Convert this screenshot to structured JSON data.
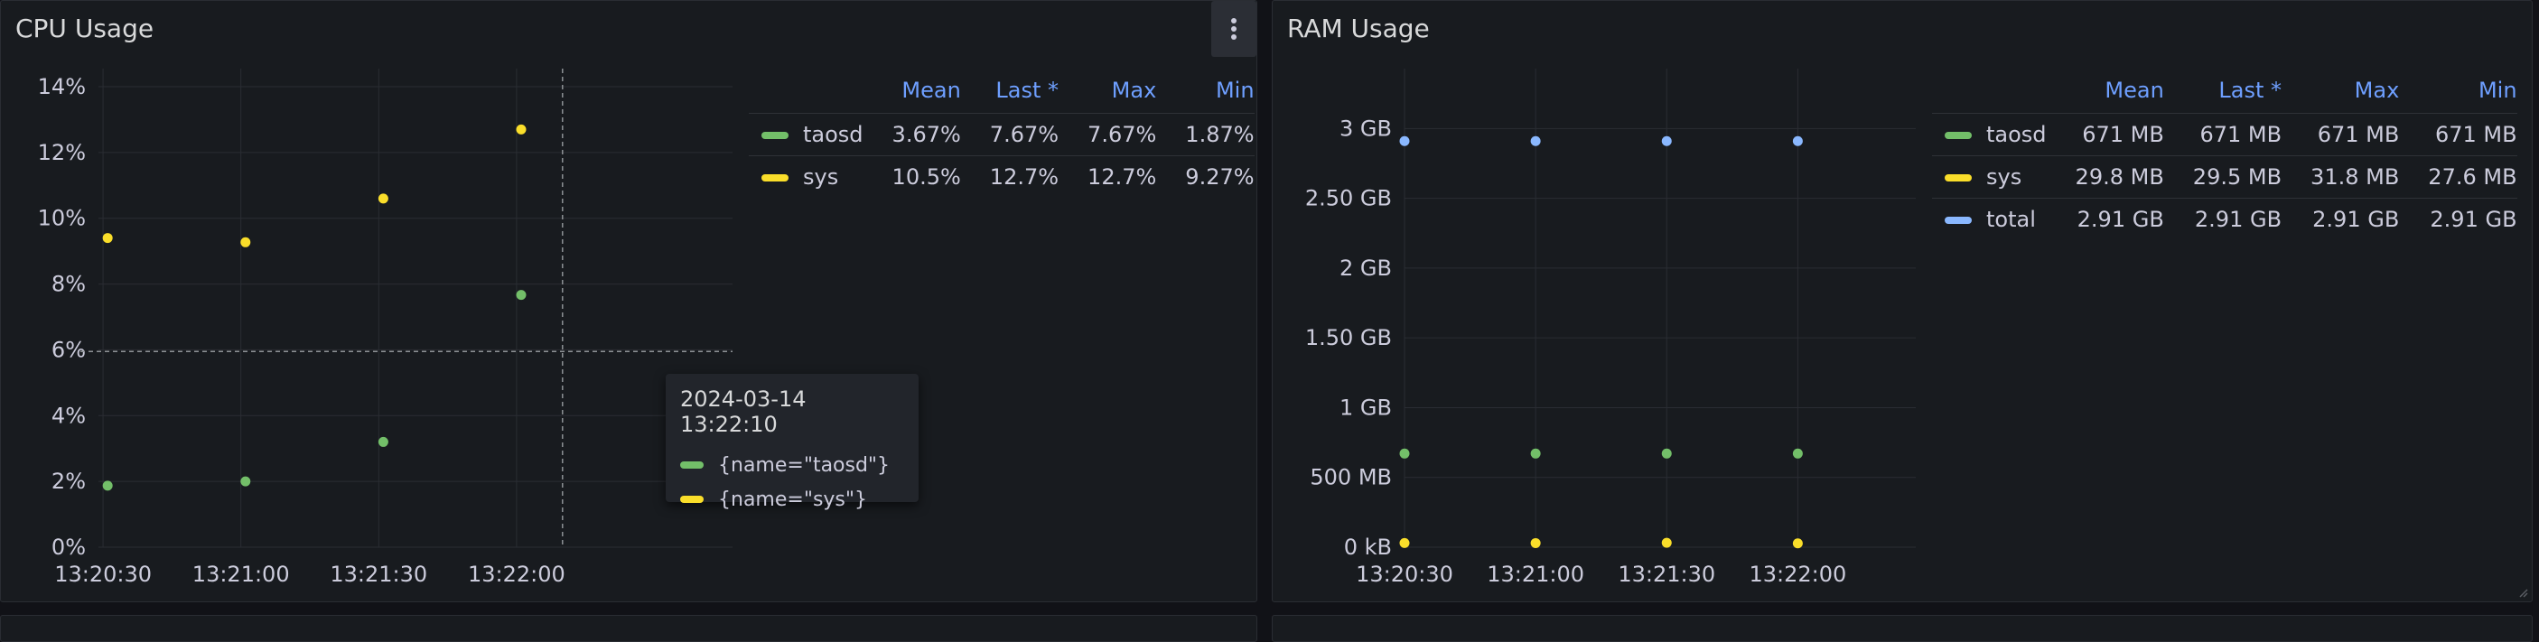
{
  "colors": {
    "taosd": "#73bf69",
    "sys": "#fade2a",
    "total": "#8ab8ff",
    "header": "#6e9fff"
  },
  "cpu_panel": {
    "title": "CPU Usage",
    "menu_icon": "kebab-menu-icon",
    "legend": {
      "headers": [
        "Mean",
        "Last *",
        "Max",
        "Min"
      ],
      "rows": [
        {
          "name": "taosd",
          "color": "#73bf69",
          "mean": "3.67%",
          "last": "7.67%",
          "max": "7.67%",
          "min": "1.87%"
        },
        {
          "name": "sys",
          "color": "#fade2a",
          "mean": "10.5%",
          "last": "12.7%",
          "max": "12.7%",
          "min": "9.27%"
        }
      ]
    },
    "tooltip": {
      "time": "2024-03-14 13:22:10",
      "items": [
        {
          "label": "{name=\"taosd\"}",
          "color": "#73bf69"
        },
        {
          "label": "{name=\"sys\"}",
          "color": "#fade2a"
        }
      ]
    }
  },
  "ram_panel": {
    "title": "RAM Usage",
    "legend": {
      "headers": [
        "Mean",
        "Last *",
        "Max",
        "Min"
      ],
      "rows": [
        {
          "name": "taosd",
          "color": "#73bf69",
          "mean": "671 MB",
          "last": "671 MB",
          "max": "671 MB",
          "min": "671 MB"
        },
        {
          "name": "sys",
          "color": "#fade2a",
          "mean": "29.8 MB",
          "last": "29.5 MB",
          "max": "31.8 MB",
          "min": "27.6 MB"
        },
        {
          "name": "total",
          "color": "#8ab8ff",
          "mean": "2.91 GB",
          "last": "2.91 GB",
          "max": "2.91 GB",
          "min": "2.91 GB"
        }
      ]
    }
  },
  "chart_data": [
    {
      "type": "scatter",
      "title": "CPU Usage",
      "x_tick_labels": [
        "13:20:30",
        "13:21:00",
        "13:21:30",
        "13:22:00"
      ],
      "y_tick_labels": [
        "0%",
        "2%",
        "4%",
        "6%",
        "8%",
        "10%",
        "12%",
        "14%"
      ],
      "xlim": [
        "13:20:29",
        "13:22:47"
      ],
      "ylim": [
        0,
        14
      ],
      "unit": "%",
      "grid": true,
      "legend": "right-table",
      "hover_x": "13:22:10",
      "hover_y": 5.95,
      "series": [
        {
          "name": "taosd",
          "color": "#73bf69",
          "x": [
            "13:20:31",
            "13:21:01",
            "13:21:31",
            "13:22:01"
          ],
          "y": [
            1.87,
            2.0,
            3.2,
            7.67
          ]
        },
        {
          "name": "sys",
          "color": "#fade2a",
          "x": [
            "13:20:31",
            "13:21:01",
            "13:21:31",
            "13:22:01"
          ],
          "y": [
            9.4,
            9.27,
            10.6,
            12.7
          ]
        }
      ]
    },
    {
      "type": "scatter",
      "title": "RAM Usage",
      "x_tick_labels": [
        "13:20:30",
        "13:21:00",
        "13:21:30",
        "13:22:00"
      ],
      "y_tick_labels": [
        "0 kB",
        "500 MB",
        "1 GB",
        "1.50 GB",
        "2 GB",
        "2.50 GB",
        "3 GB"
      ],
      "xlim": [
        "13:20:30",
        "13:22:27"
      ],
      "ylim_mb": [
        0,
        3300
      ],
      "unit": "MB",
      "grid": true,
      "legend": "right-table",
      "series": [
        {
          "name": "taosd",
          "color": "#73bf69",
          "x": [
            "13:20:30",
            "13:21:00",
            "13:21:30",
            "13:22:00"
          ],
          "y": [
            671,
            671,
            671,
            671
          ]
        },
        {
          "name": "sys",
          "color": "#fade2a",
          "x": [
            "13:20:30",
            "13:21:00",
            "13:21:30",
            "13:22:00"
          ],
          "y": [
            29.8,
            29.5,
            31.8,
            27.6
          ]
        },
        {
          "name": "total",
          "color": "#8ab8ff",
          "x": [
            "13:20:30",
            "13:21:00",
            "13:21:30",
            "13:22:00"
          ],
          "y": [
            2910,
            2910,
            2910,
            2910
          ]
        }
      ]
    }
  ]
}
